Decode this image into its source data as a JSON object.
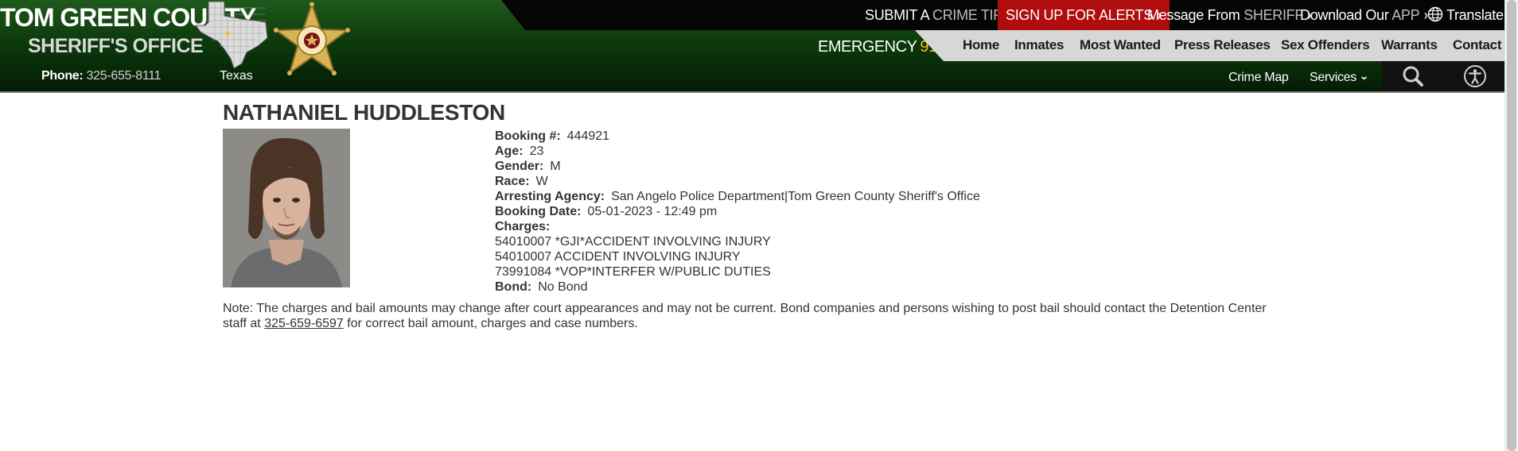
{
  "header": {
    "brand_title": "TOM GREEN COUNTY",
    "brand_subtitle": "SHERIFF'S OFFICE",
    "phone_label": "Phone:",
    "phone_number": "325-655-8111",
    "state_label": "Texas",
    "emergency_label": "EMERGENCY",
    "emergency_number": "911",
    "top_links": [
      {
        "prefix": "SUBMIT A",
        "highlight": "CRIME TIP"
      },
      {
        "text": "SIGN UP FOR ALERTS"
      },
      {
        "prefix": "Message From",
        "highlight": "SHERIFF"
      },
      {
        "prefix": "Download Our",
        "highlight": "APP"
      },
      {
        "text": "Translate"
      }
    ],
    "nav": [
      "Home",
      "Inmates",
      "Most Wanted",
      "Press Releases",
      "Sex Offenders",
      "Warrants",
      "Contact"
    ],
    "secondary_nav": {
      "crime_map": "Crime Map",
      "services": "Services"
    },
    "colors": {
      "alert_red": "#b00e0e",
      "emergency_yellow": "#f2c014",
      "header_green": "#0c3a0c"
    }
  },
  "inmate": {
    "name": "NATHANIEL HUDDLESTON",
    "fields": [
      {
        "label": "Booking #:",
        "value": "444921"
      },
      {
        "label": "Age:",
        "value": "23"
      },
      {
        "label": "Gender:",
        "value": "M"
      },
      {
        "label": "Race:",
        "value": "W"
      },
      {
        "label": "Arresting Agency:",
        "value": "San Angelo Police Department|Tom Green County Sheriff's Office"
      },
      {
        "label": "Booking Date:",
        "value": "05-01-2023 - 12:49 pm"
      }
    ],
    "charges_label": "Charges:",
    "charges": [
      "54010007 *GJI*ACCIDENT INVOLVING INJURY",
      "54010007 ACCIDENT INVOLVING INJURY",
      "73991084 *VOP*INTERFER W/PUBLIC DUTIES"
    ],
    "bond_label": "Bond:",
    "bond_value": "No Bond"
  },
  "note": {
    "before": "Note: The charges and bail amounts may change after court appearances and may not be current. Bond companies and persons wishing to post bail should contact the Detention Center staff at ",
    "phone": "325-659-6597",
    "after": " for correct bail amount, charges and case numbers."
  }
}
